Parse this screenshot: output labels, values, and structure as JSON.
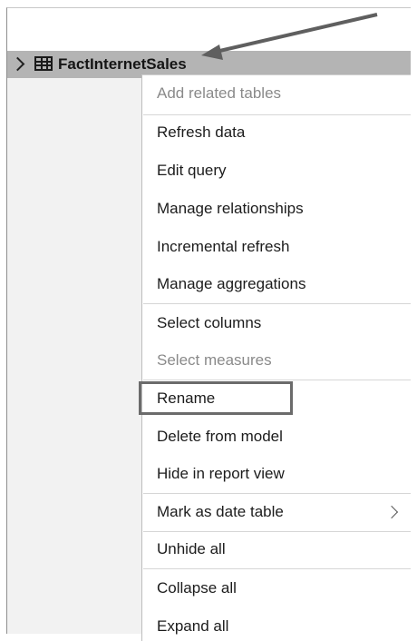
{
  "table": {
    "name": "FactInternetSales"
  },
  "menu": {
    "items": [
      {
        "label": "Add related tables",
        "disabled": true
      },
      {
        "label": "Refresh data"
      },
      {
        "label": "Edit query"
      },
      {
        "label": "Manage relationships"
      },
      {
        "label": "Incremental refresh"
      },
      {
        "label": "Manage aggregations"
      },
      {
        "label": "Select columns"
      },
      {
        "label": "Select measures",
        "disabled": true
      },
      {
        "label": "Rename",
        "highlighted": true
      },
      {
        "label": "Delete from model"
      },
      {
        "label": "Hide in report view"
      },
      {
        "label": "Mark as date table",
        "has_submenu": true
      },
      {
        "label": "Unhide all"
      },
      {
        "label": "Collapse all"
      },
      {
        "label": "Expand all"
      }
    ]
  },
  "icons": {
    "expand": "chevron-right-icon",
    "table": "table-icon",
    "submenu": "chevron-right-icon",
    "annotation": "arrow-annotation"
  }
}
